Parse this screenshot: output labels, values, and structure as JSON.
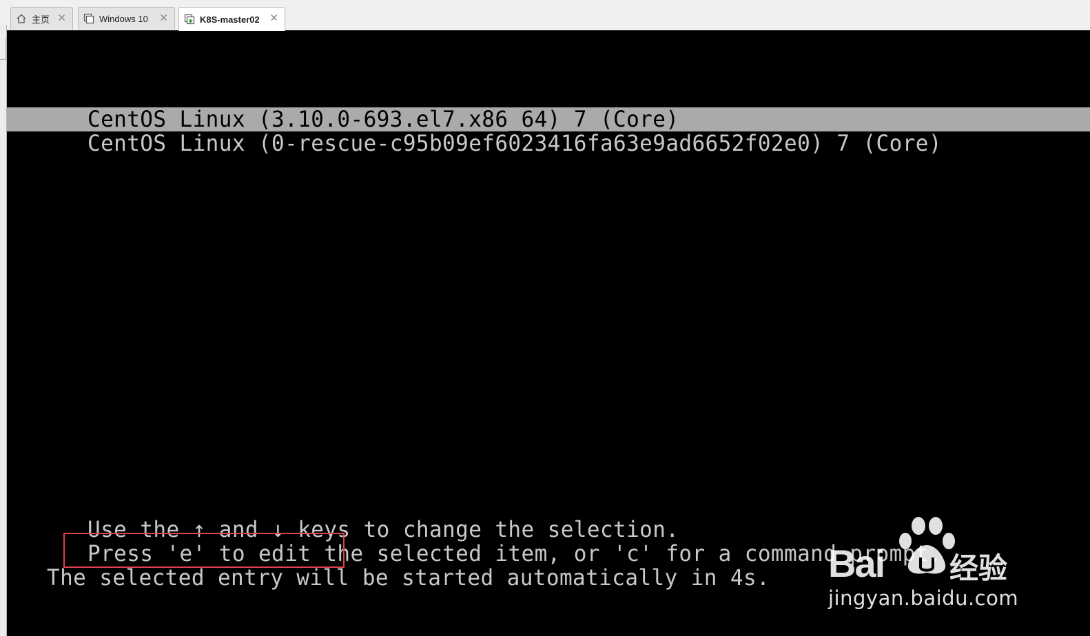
{
  "tabs": [
    {
      "label": "主页",
      "icon": "home-icon",
      "active": false
    },
    {
      "label": "Windows 10",
      "icon": "vm-icon",
      "active": false
    },
    {
      "label": "K8S-master02",
      "icon": "vm-running-icon",
      "active": true
    }
  ],
  "close_glyph": "✕",
  "grub": {
    "entries": [
      {
        "label": "CentOS Linux (3.10.0-693.el7.x86_64) 7 (Core)",
        "selected": true
      },
      {
        "label": "CentOS Linux (0-rescue-c95b09ef6023416fa63e9ad6652f02e0) 7 (Core)",
        "selected": false
      }
    ],
    "help": [
      "Use the ↑ and ↓ keys to change the selection.",
      "Press 'e' to edit the selected item, or 'c' for a command prompt.",
      "The selected entry will be started automatically in 4s."
    ]
  },
  "watermark": {
    "logo": "Bai",
    "logo_cn": "经验",
    "url": "jingyan.baidu.com"
  },
  "colors": {
    "console_bg": "#000000",
    "console_text": "#c8c8c8",
    "selection_bg": "#aaaaaa",
    "highlight_box": "#e0414a"
  }
}
